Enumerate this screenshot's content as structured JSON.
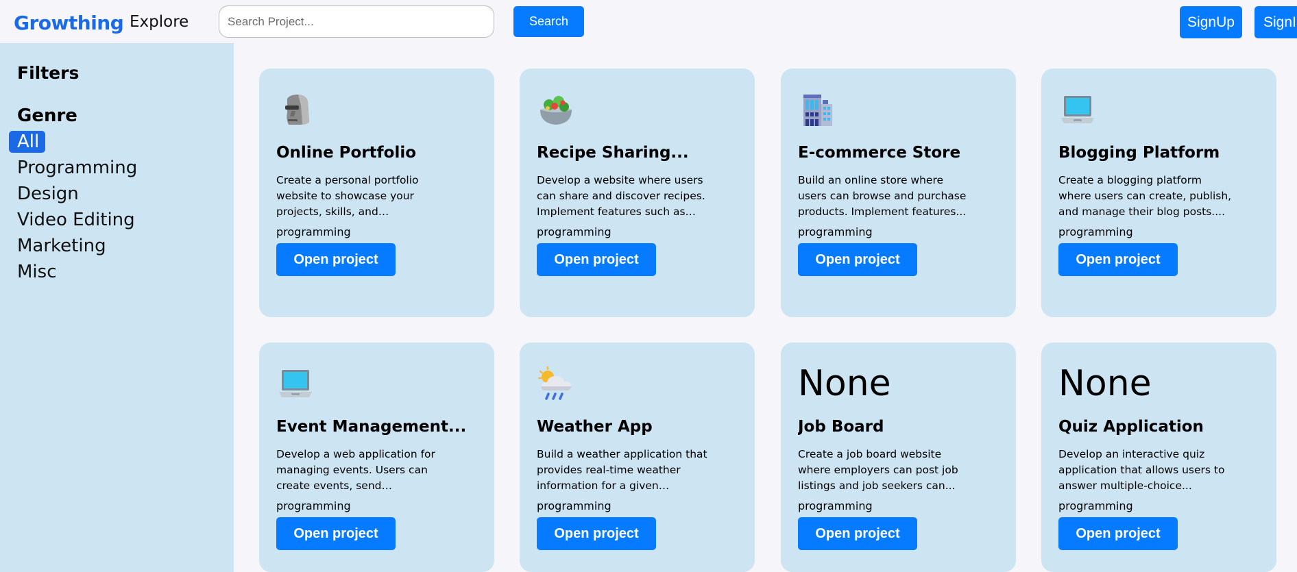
{
  "header": {
    "brand": "Growthing",
    "explore_label": "Explore",
    "search_placeholder": "Search Project...",
    "search_label": "Search",
    "signup_label": "SignUp",
    "signin_label": "SignIn"
  },
  "sidebar": {
    "filters_title": "Filters",
    "genre_title": "Genre",
    "genres": [
      "All",
      "Programming",
      "Design",
      "Video Editing",
      "Marketing",
      "Misc"
    ],
    "active_genre": "All"
  },
  "colors": {
    "accent": "#077bff",
    "brand": "#1a6ae8",
    "card_bg": "#cde4f3",
    "page_bg": "#f5f5fa"
  },
  "projects": [
    {
      "icon": "moai-icon",
      "title": "Online Portfolio",
      "description": "Create a personal portfolio website to showcase your projects, skills, and experience....",
      "tag": "programming",
      "button": "Open project"
    },
    {
      "icon": "salad-icon",
      "title": "Recipe Sharing...",
      "description": "Develop a website where users can share and discover recipes. Implement features such as use...",
      "tag": "programming",
      "button": "Open project"
    },
    {
      "icon": "office-building-icon",
      "title": "E-commerce Store",
      "description": "Build an online store where users can browse and purchase products. Implement features...",
      "tag": "programming",
      "button": "Open project"
    },
    {
      "icon": "laptop-icon",
      "title": "Blogging Platform",
      "description": "Create a blogging platform where users can create, publish, and manage their blog posts....",
      "tag": "programming",
      "button": "Open project"
    },
    {
      "icon": "laptop-icon",
      "title": "Event Management...",
      "description": "Develop a web application for managing events. Users can create events, send invitations,...",
      "tag": "programming",
      "button": "Open project"
    },
    {
      "icon": "rain-cloud-sun-icon",
      "title": "Weather App",
      "description": "Build a weather application that provides real-time weather information for a given location....",
      "tag": "programming",
      "button": "Open project"
    },
    {
      "icon_text": "None",
      "title": "Job Board",
      "description": "Create a job board website where employers can post job listings and job seekers can...",
      "tag": "programming",
      "button": "Open project"
    },
    {
      "icon_text": "None",
      "title": "Quiz Application",
      "description": "Develop an interactive quiz application that allows users to answer multiple-choice...",
      "tag": "programming",
      "button": "Open project"
    }
  ]
}
